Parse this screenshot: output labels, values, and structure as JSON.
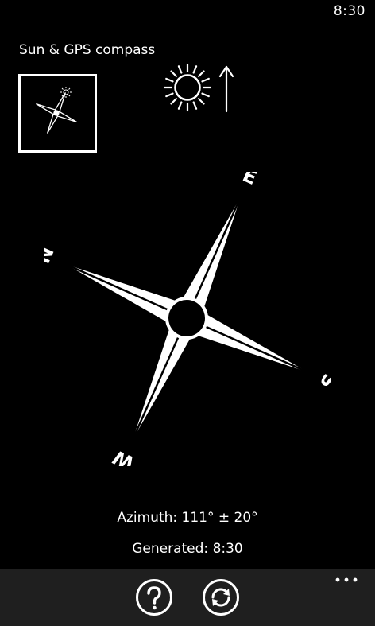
{
  "status_bar": {
    "time": "8:30"
  },
  "app": {
    "title": "Sun & GPS compass"
  },
  "compass": {
    "labels": {
      "north": "N",
      "east": "E",
      "south": "S",
      "west": "W"
    },
    "azimuth_label": "Azimuth:",
    "azimuth_value": "111°",
    "azimuth_accuracy": "± 20°",
    "generated_label": "Generated:",
    "generated_time": "8:30"
  },
  "app_bar": {
    "buttons": [
      {
        "icon": "help-icon"
      },
      {
        "icon": "refresh-icon"
      }
    ],
    "more_icon": "more-ellipsis-icon"
  },
  "colors": {
    "background": "#000000",
    "foreground": "#ffffff",
    "app_bar": "#1f1f1f"
  }
}
